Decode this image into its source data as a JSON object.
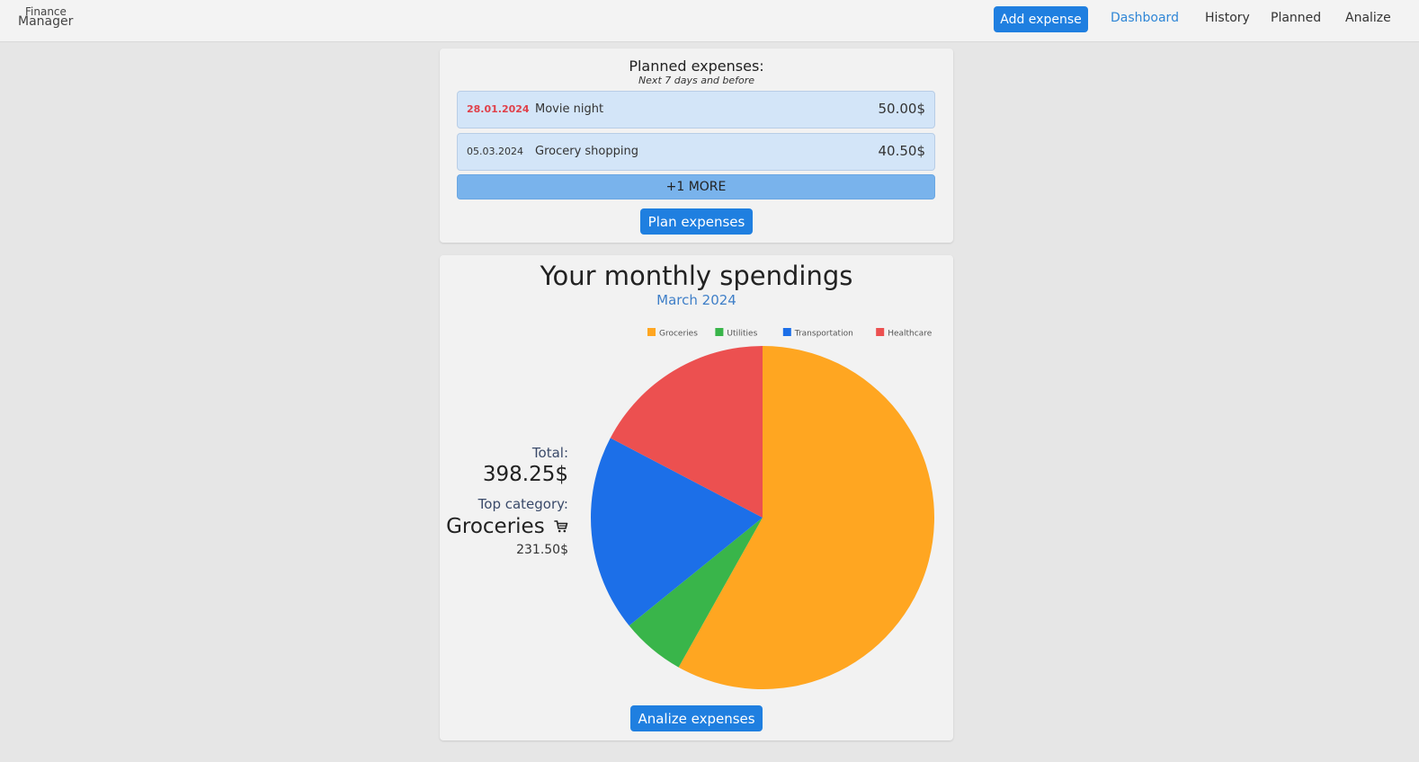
{
  "app": {
    "brand_top": "Finance",
    "brand_bottom": "Manager"
  },
  "nav": {
    "add_expense": "Add expense",
    "links": [
      "Dashboard",
      "History",
      "Planned",
      "Analize"
    ],
    "active": "Dashboard"
  },
  "planned": {
    "title": "Planned expenses:",
    "subtitle": "Next 7 days and before",
    "items": [
      {
        "date": "28.01.2024",
        "name": "Movie night",
        "amount": "50.00$",
        "overdue": true
      },
      {
        "date": "05.03.2024",
        "name": "Grocery shopping",
        "amount": "40.50$",
        "overdue": false
      }
    ],
    "more_label": "+1 MORE",
    "plan_button": "Plan expenses"
  },
  "monthly": {
    "title": "Your monthly spendings",
    "subtitle": "March 2024",
    "total_label": "Total:",
    "total_value": "398.25$",
    "top_category_label": "Top category:",
    "top_category": "Groceries",
    "top_category_icon": "shopping-cart-icon",
    "top_category_amount": "231.50$",
    "analize_button": "Analize expenses"
  },
  "chart_data": {
    "type": "pie",
    "categories": [
      "Groceries",
      "Utilities",
      "Transportation",
      "Healthcare"
    ],
    "values": [
      231.5,
      24.0,
      73.75,
      69.0
    ],
    "colors": [
      "#ffa621",
      "#39b54a",
      "#1c6fe8",
      "#ec5050"
    ],
    "legend": "top"
  }
}
